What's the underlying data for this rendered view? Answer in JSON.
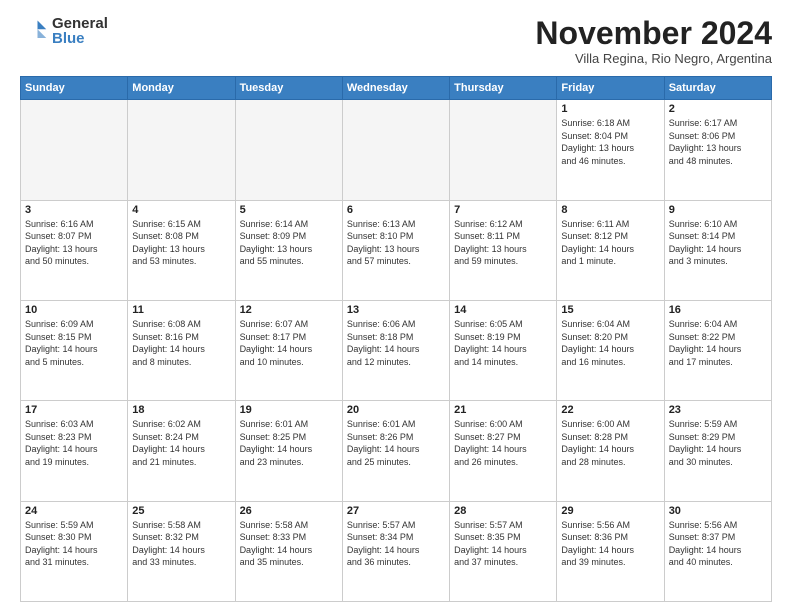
{
  "logo": {
    "general": "General",
    "blue": "Blue"
  },
  "header": {
    "month": "November 2024",
    "location": "Villa Regina, Rio Negro, Argentina"
  },
  "days_of_week": [
    "Sunday",
    "Monday",
    "Tuesday",
    "Wednesday",
    "Thursday",
    "Friday",
    "Saturday"
  ],
  "weeks": [
    [
      {
        "day": "",
        "info": ""
      },
      {
        "day": "",
        "info": ""
      },
      {
        "day": "",
        "info": ""
      },
      {
        "day": "",
        "info": ""
      },
      {
        "day": "",
        "info": ""
      },
      {
        "day": "1",
        "info": "Sunrise: 6:18 AM\nSunset: 8:04 PM\nDaylight: 13 hours\nand 46 minutes."
      },
      {
        "day": "2",
        "info": "Sunrise: 6:17 AM\nSunset: 8:06 PM\nDaylight: 13 hours\nand 48 minutes."
      }
    ],
    [
      {
        "day": "3",
        "info": "Sunrise: 6:16 AM\nSunset: 8:07 PM\nDaylight: 13 hours\nand 50 minutes."
      },
      {
        "day": "4",
        "info": "Sunrise: 6:15 AM\nSunset: 8:08 PM\nDaylight: 13 hours\nand 53 minutes."
      },
      {
        "day": "5",
        "info": "Sunrise: 6:14 AM\nSunset: 8:09 PM\nDaylight: 13 hours\nand 55 minutes."
      },
      {
        "day": "6",
        "info": "Sunrise: 6:13 AM\nSunset: 8:10 PM\nDaylight: 13 hours\nand 57 minutes."
      },
      {
        "day": "7",
        "info": "Sunrise: 6:12 AM\nSunset: 8:11 PM\nDaylight: 13 hours\nand 59 minutes."
      },
      {
        "day": "8",
        "info": "Sunrise: 6:11 AM\nSunset: 8:12 PM\nDaylight: 14 hours\nand 1 minute."
      },
      {
        "day": "9",
        "info": "Sunrise: 6:10 AM\nSunset: 8:14 PM\nDaylight: 14 hours\nand 3 minutes."
      }
    ],
    [
      {
        "day": "10",
        "info": "Sunrise: 6:09 AM\nSunset: 8:15 PM\nDaylight: 14 hours\nand 5 minutes."
      },
      {
        "day": "11",
        "info": "Sunrise: 6:08 AM\nSunset: 8:16 PM\nDaylight: 14 hours\nand 8 minutes."
      },
      {
        "day": "12",
        "info": "Sunrise: 6:07 AM\nSunset: 8:17 PM\nDaylight: 14 hours\nand 10 minutes."
      },
      {
        "day": "13",
        "info": "Sunrise: 6:06 AM\nSunset: 8:18 PM\nDaylight: 14 hours\nand 12 minutes."
      },
      {
        "day": "14",
        "info": "Sunrise: 6:05 AM\nSunset: 8:19 PM\nDaylight: 14 hours\nand 14 minutes."
      },
      {
        "day": "15",
        "info": "Sunrise: 6:04 AM\nSunset: 8:20 PM\nDaylight: 14 hours\nand 16 minutes."
      },
      {
        "day": "16",
        "info": "Sunrise: 6:04 AM\nSunset: 8:22 PM\nDaylight: 14 hours\nand 17 minutes."
      }
    ],
    [
      {
        "day": "17",
        "info": "Sunrise: 6:03 AM\nSunset: 8:23 PM\nDaylight: 14 hours\nand 19 minutes."
      },
      {
        "day": "18",
        "info": "Sunrise: 6:02 AM\nSunset: 8:24 PM\nDaylight: 14 hours\nand 21 minutes."
      },
      {
        "day": "19",
        "info": "Sunrise: 6:01 AM\nSunset: 8:25 PM\nDaylight: 14 hours\nand 23 minutes."
      },
      {
        "day": "20",
        "info": "Sunrise: 6:01 AM\nSunset: 8:26 PM\nDaylight: 14 hours\nand 25 minutes."
      },
      {
        "day": "21",
        "info": "Sunrise: 6:00 AM\nSunset: 8:27 PM\nDaylight: 14 hours\nand 26 minutes."
      },
      {
        "day": "22",
        "info": "Sunrise: 6:00 AM\nSunset: 8:28 PM\nDaylight: 14 hours\nand 28 minutes."
      },
      {
        "day": "23",
        "info": "Sunrise: 5:59 AM\nSunset: 8:29 PM\nDaylight: 14 hours\nand 30 minutes."
      }
    ],
    [
      {
        "day": "24",
        "info": "Sunrise: 5:59 AM\nSunset: 8:30 PM\nDaylight: 14 hours\nand 31 minutes."
      },
      {
        "day": "25",
        "info": "Sunrise: 5:58 AM\nSunset: 8:32 PM\nDaylight: 14 hours\nand 33 minutes."
      },
      {
        "day": "26",
        "info": "Sunrise: 5:58 AM\nSunset: 8:33 PM\nDaylight: 14 hours\nand 35 minutes."
      },
      {
        "day": "27",
        "info": "Sunrise: 5:57 AM\nSunset: 8:34 PM\nDaylight: 14 hours\nand 36 minutes."
      },
      {
        "day": "28",
        "info": "Sunrise: 5:57 AM\nSunset: 8:35 PM\nDaylight: 14 hours\nand 37 minutes."
      },
      {
        "day": "29",
        "info": "Sunrise: 5:56 AM\nSunset: 8:36 PM\nDaylight: 14 hours\nand 39 minutes."
      },
      {
        "day": "30",
        "info": "Sunrise: 5:56 AM\nSunset: 8:37 PM\nDaylight: 14 hours\nand 40 minutes."
      }
    ]
  ]
}
